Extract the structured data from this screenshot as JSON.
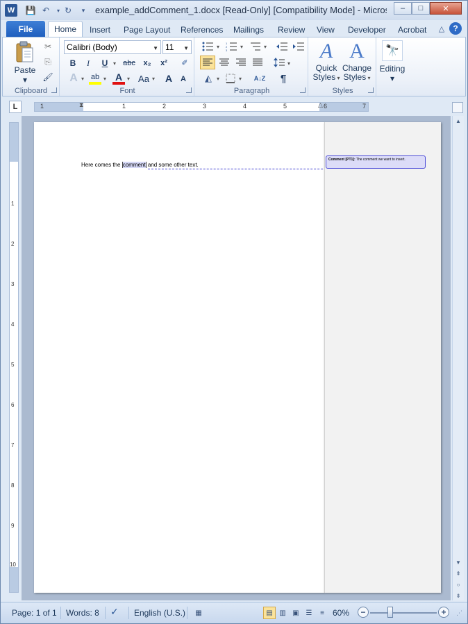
{
  "window": {
    "title": "example_addComment_1.docx [Read-Only] [Compatibility Mode]  -  Micros…",
    "app_icon_letter": "W",
    "controls": {
      "minimize": "–",
      "maximize": "□",
      "close": "✕"
    }
  },
  "quick_access": {
    "save_icon": "💾",
    "undo_icon": "↶",
    "redo_icon": "↻",
    "customize_icon": "▾"
  },
  "tabs": {
    "file": "File",
    "items": [
      "Home",
      "Insert",
      "Page Layout",
      "References",
      "Mailings",
      "Review",
      "View",
      "Developer",
      "Acrobat"
    ],
    "collapse_icon": "△",
    "help_icon": "?"
  },
  "ribbon": {
    "clipboard": {
      "label": "Clipboard",
      "paste": "Paste",
      "cut_icon": "✂",
      "copy_icon": "⎘",
      "format_painter_icon": "🖌"
    },
    "font": {
      "label": "Font",
      "family": "Calibri (Body)",
      "size": "11",
      "bold": "B",
      "italic": "I",
      "underline": "U",
      "strike": "abc",
      "subscript": "x₂",
      "superscript": "x²",
      "clear_format": "A",
      "highlight": "ab",
      "font_color": "A",
      "change_case": "Aa",
      "grow": "A",
      "shrink": "A"
    },
    "paragraph": {
      "label": "Paragraph",
      "pilcrow": "¶",
      "sort": "A↓Z"
    },
    "styles": {
      "label": "Styles",
      "quick_styles": [
        "Quick",
        "Styles"
      ],
      "change_styles": [
        "Change",
        "Styles"
      ]
    },
    "editing": {
      "label": "Editing"
    }
  },
  "ruler": {
    "tab_selector": "L",
    "h_numbers": [
      "1",
      "1",
      "2",
      "3",
      "4",
      "5",
      "6",
      "7"
    ],
    "v_numbers": [
      "1",
      "2",
      "3",
      "4",
      "5",
      "6",
      "7",
      "8",
      "9",
      "10"
    ]
  },
  "document": {
    "text_before": "Here comes the ",
    "commented_word": "comment",
    "text_after": " and some other text.",
    "comment": {
      "author": "Comment [PT1]:",
      "body": " The comment we want to insert."
    }
  },
  "statusbar": {
    "page": "Page: 1 of 1",
    "words": "Words: 8",
    "language": "English (U.S.)",
    "zoom": "60%",
    "zoom_level": 0.6
  },
  "colors": {
    "accent": "#2b5797",
    "comment_border": "#4a4ad8",
    "comment_fill": "#dcdcf8"
  }
}
